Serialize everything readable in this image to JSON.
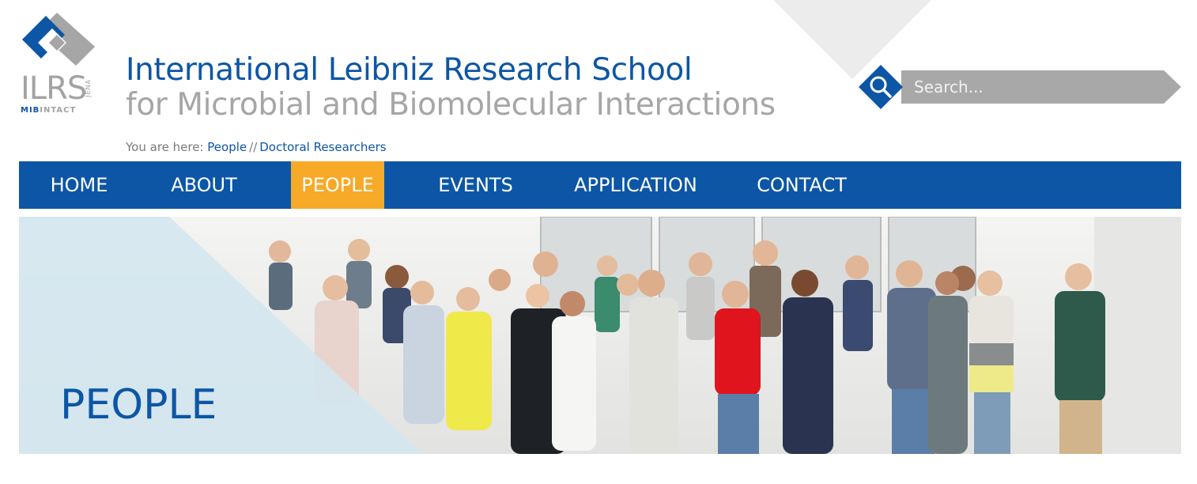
{
  "header": {
    "logo": {
      "text": "ILRS",
      "vertical_text": "JENA",
      "sub_text_bold": "MIB",
      "sub_text": "INTACT"
    },
    "title_line1": "International Leibniz Research School",
    "title_line2": "for Microbial and Biomolecular Interactions"
  },
  "search": {
    "placeholder": "Search...",
    "icon": "magnifier-icon"
  },
  "breadcrumb": {
    "prefix": "You are here:",
    "items": [
      "People",
      "Doctoral Researchers"
    ],
    "separator": "//"
  },
  "nav": {
    "items": [
      {
        "label": "HOME"
      },
      {
        "label": "ABOUT"
      },
      {
        "label": "PEOPLE"
      },
      {
        "label": "EVENTS"
      },
      {
        "label": "APPLICATION"
      },
      {
        "label": "CONTACT"
      }
    ],
    "active": "PEOPLE"
  },
  "hero": {
    "title": "PEOPLE",
    "image": "group-photo"
  },
  "colors": {
    "brand_blue": "#0d56a6",
    "accent_orange": "#f7a928",
    "grey_text": "#a6a6a6",
    "search_bar": "#a8a8a8",
    "hero_overlay": "#d3e6ef"
  }
}
